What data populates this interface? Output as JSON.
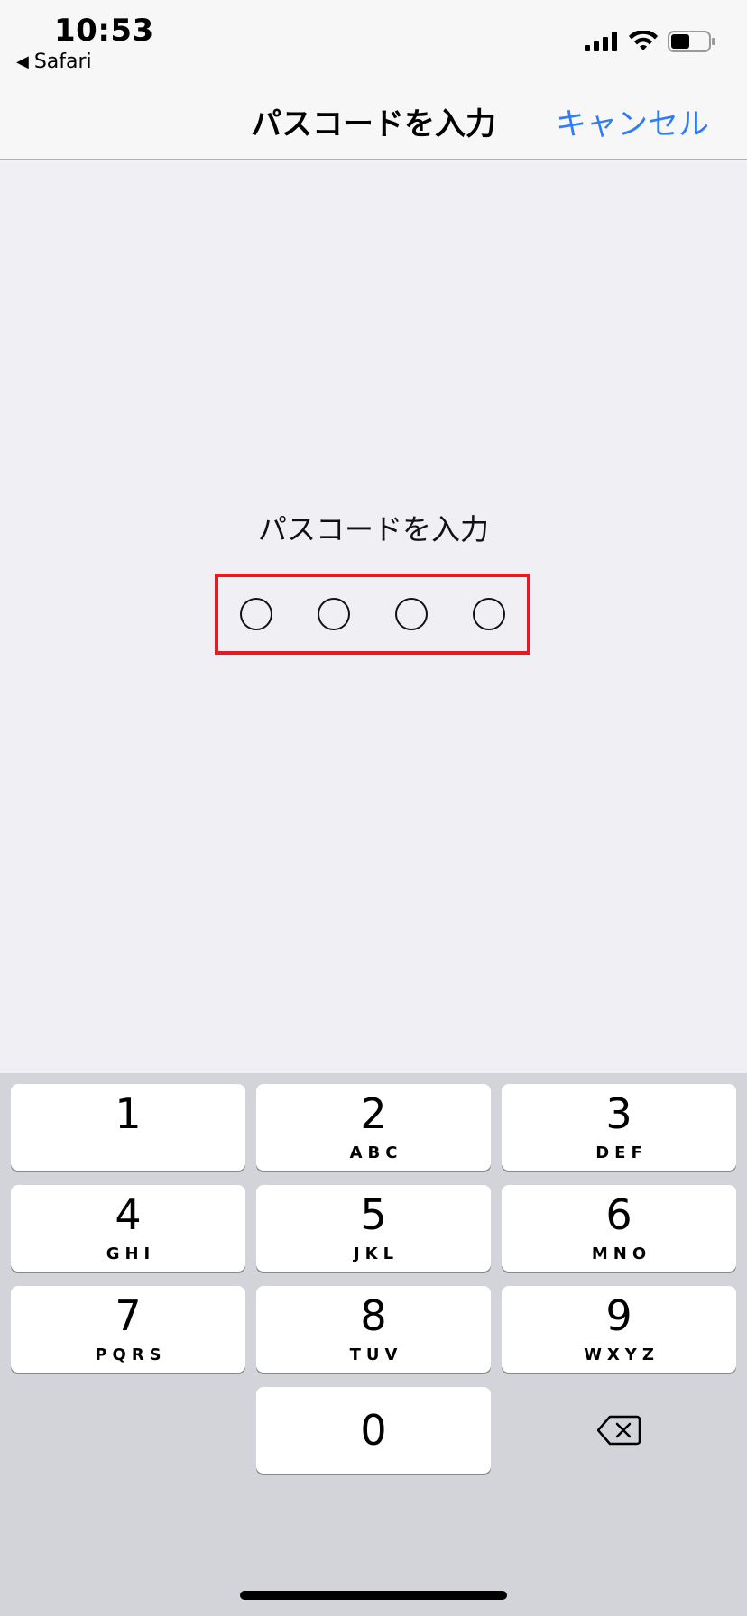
{
  "status_bar": {
    "time": "10:53",
    "back_app": "Safari",
    "icons": [
      "signal-icon",
      "wifi-icon",
      "battery-icon"
    ],
    "battery_level": 0.5
  },
  "nav": {
    "title": "パスコードを入力",
    "cancel": "キャンセル",
    "accent_color": "#2f7cf6"
  },
  "content": {
    "prompt": "パスコードを入力",
    "passcode_length": 4,
    "entered_digits": 0,
    "highlight_color": "#e41b23"
  },
  "keypad": {
    "keys": [
      {
        "num": "1",
        "letters": ""
      },
      {
        "num": "2",
        "letters": "ABC"
      },
      {
        "num": "3",
        "letters": "DEF"
      },
      {
        "num": "4",
        "letters": "GHI"
      },
      {
        "num": "5",
        "letters": "JKL"
      },
      {
        "num": "6",
        "letters": "MNO"
      },
      {
        "num": "7",
        "letters": "PQRS"
      },
      {
        "num": "8",
        "letters": "TUV"
      },
      {
        "num": "9",
        "letters": "WXYZ"
      },
      {
        "num": "0",
        "letters": ""
      }
    ],
    "delete_icon": "backspace-icon"
  }
}
